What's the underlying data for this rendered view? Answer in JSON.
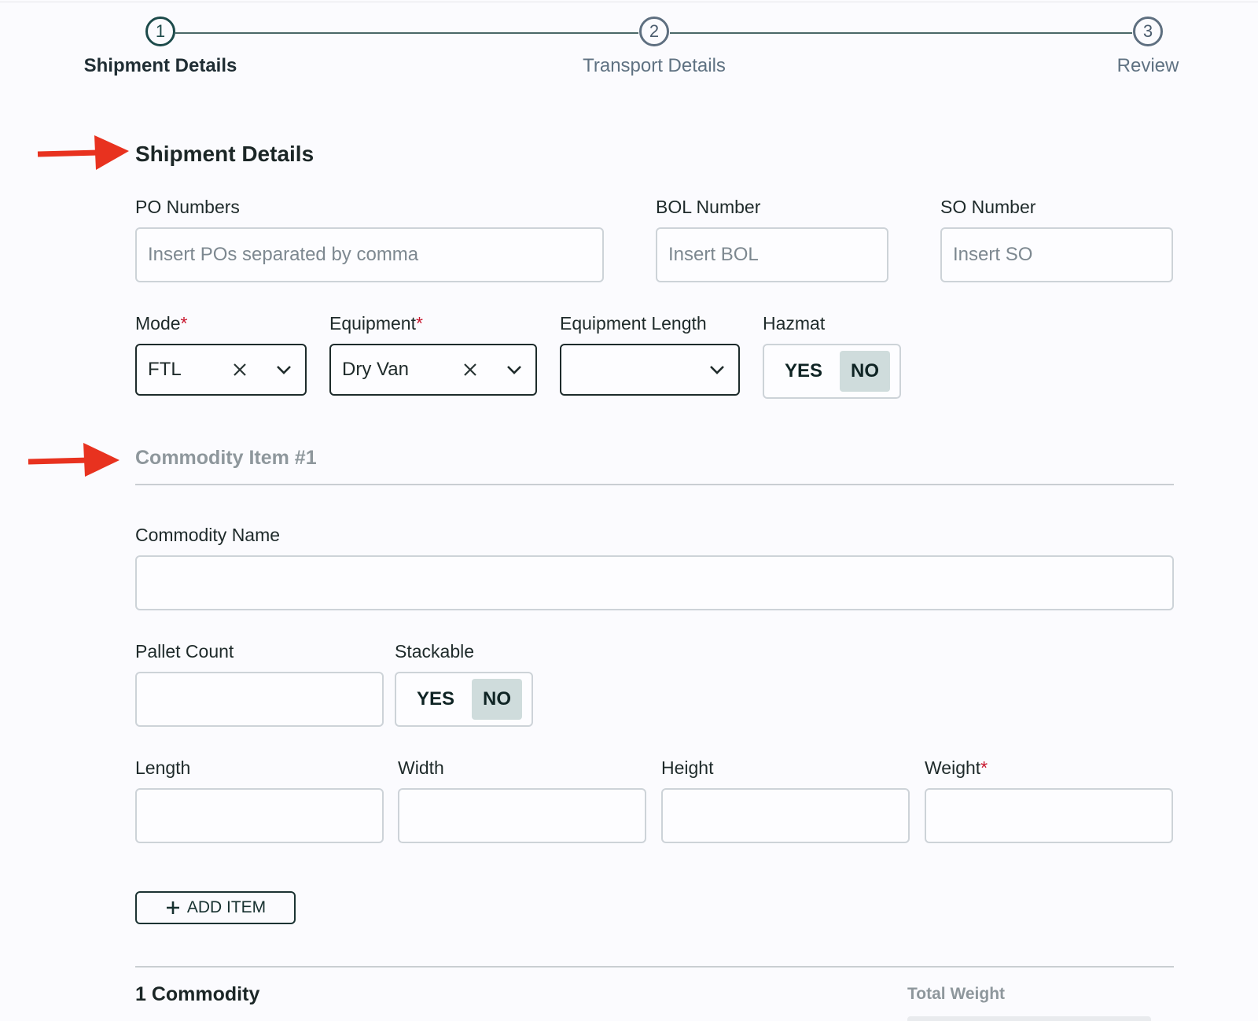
{
  "stepper": {
    "steps": [
      {
        "number": "1",
        "label": "Shipment Details"
      },
      {
        "number": "2",
        "label": "Transport Details"
      },
      {
        "number": "3",
        "label": "Review"
      }
    ],
    "active_step": 1
  },
  "shipment": {
    "title": "Shipment Details",
    "po": {
      "label": "PO Numbers",
      "placeholder": "Insert POs separated by comma"
    },
    "bol": {
      "label": "BOL Number",
      "placeholder": "Insert BOL"
    },
    "so": {
      "label": "SO Number",
      "placeholder": "Insert SO"
    },
    "mode": {
      "label": "Mode",
      "value": "FTL",
      "required_mark": "*"
    },
    "equipment": {
      "label": "Equipment",
      "value": "Dry Van",
      "required_mark": "*"
    },
    "equipment_length": {
      "label": "Equipment Length",
      "value": ""
    },
    "hazmat": {
      "label": "Hazmat",
      "yes": "YES",
      "no": "NO",
      "selected": "NO"
    }
  },
  "commodity": {
    "title": "Commodity Item #1",
    "name": {
      "label": "Commodity Name",
      "value": ""
    },
    "pallet_count": {
      "label": "Pallet Count",
      "value": ""
    },
    "stackable": {
      "label": "Stackable",
      "yes": "YES",
      "no": "NO",
      "selected": "NO"
    },
    "length": {
      "label": "Length"
    },
    "width": {
      "label": "Width"
    },
    "height": {
      "label": "Height"
    },
    "weight": {
      "label": "Weight",
      "required_mark": "*"
    },
    "add_item_label": "ADD ITEM"
  },
  "summary": {
    "count_text": "1 Commodity",
    "total_weight_label": "Total Weight"
  },
  "annotations": {
    "arrow_color": "#e8321f"
  },
  "icons": {
    "clear": "close-icon",
    "dropdown": "chevron-down-icon",
    "add": "plus-icon",
    "arrow": "red-arrow-annotation"
  }
}
